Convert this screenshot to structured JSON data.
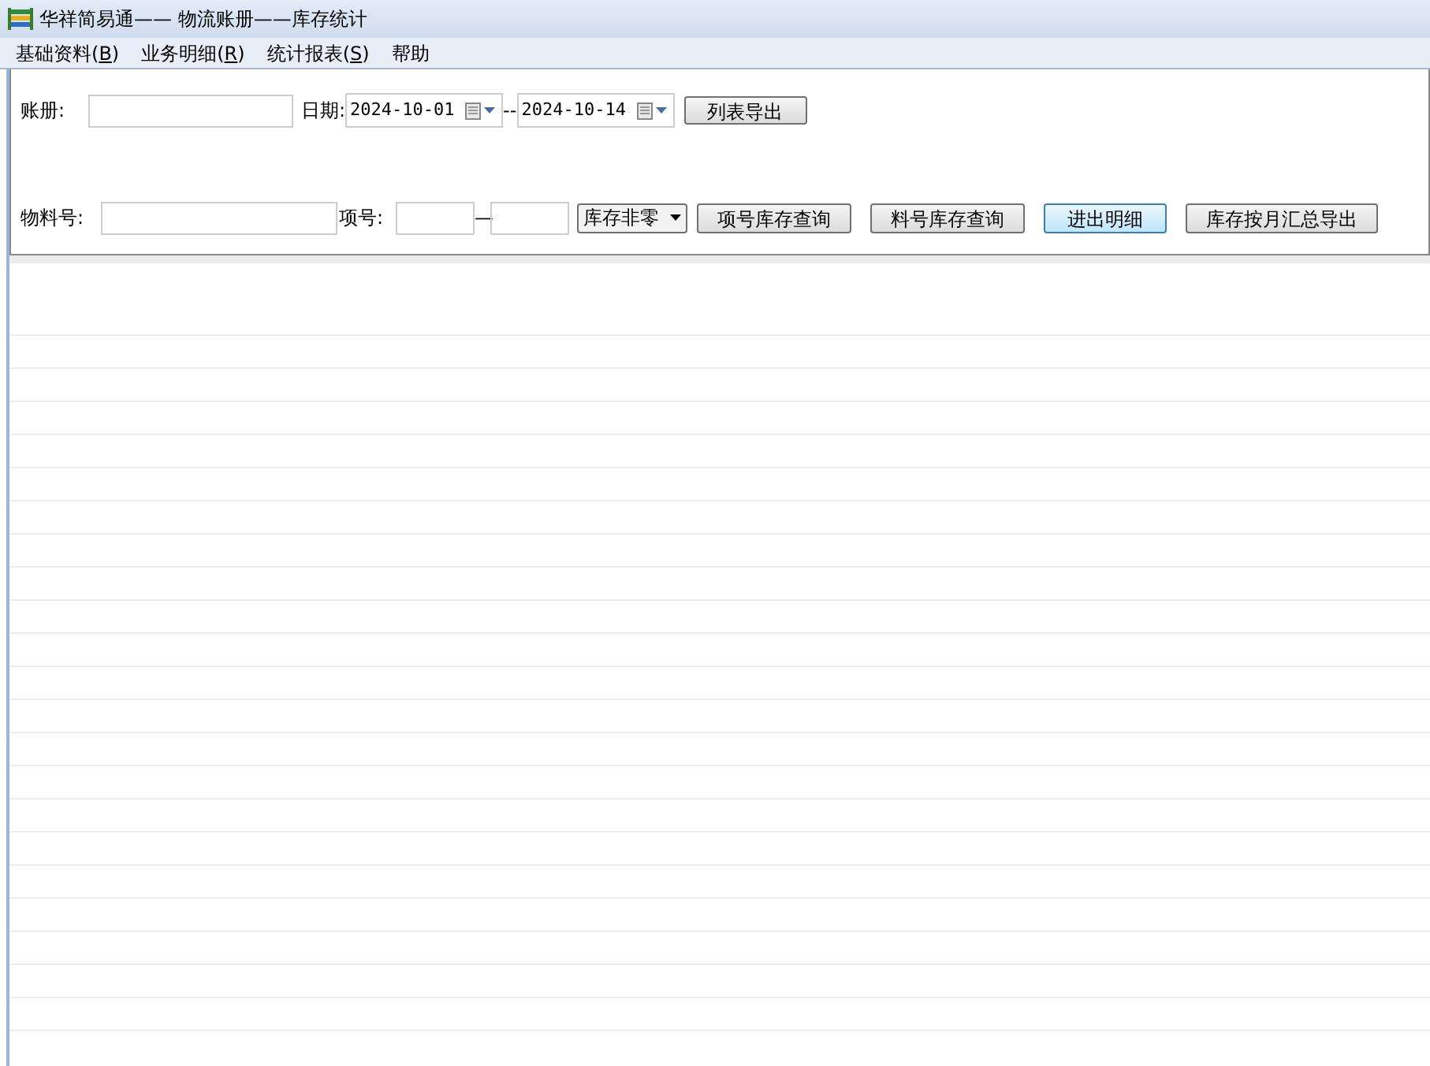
{
  "window": {
    "title": "华祥简易通—— 物流账册——库存统计"
  },
  "menu": [
    {
      "before": "基础资料(",
      "key": "B",
      "after": ")"
    },
    {
      "before": "业务明细(",
      "key": "R",
      "after": ")"
    },
    {
      "before": "统计报表(",
      "key": "S",
      "after": ")"
    },
    {
      "before": "帮助"
    }
  ],
  "filters": {
    "ledger_label": "账册:",
    "date_label": "日期:",
    "date_from": "2024-10-01",
    "date_separator": "--",
    "date_to": "2024-10-14",
    "export_list_button": "列表导出",
    "material_label": "物料号:",
    "item_label": "项号:",
    "item_separator": "—",
    "stock_filter": "库存非零"
  },
  "buttons": [
    {
      "label": "项号库存查询",
      "selected": false
    },
    {
      "label": "料号库存查询",
      "selected": false
    },
    {
      "label": "进出明细",
      "selected": true
    },
    {
      "label": "库存按月汇总导出",
      "selected": false
    }
  ]
}
